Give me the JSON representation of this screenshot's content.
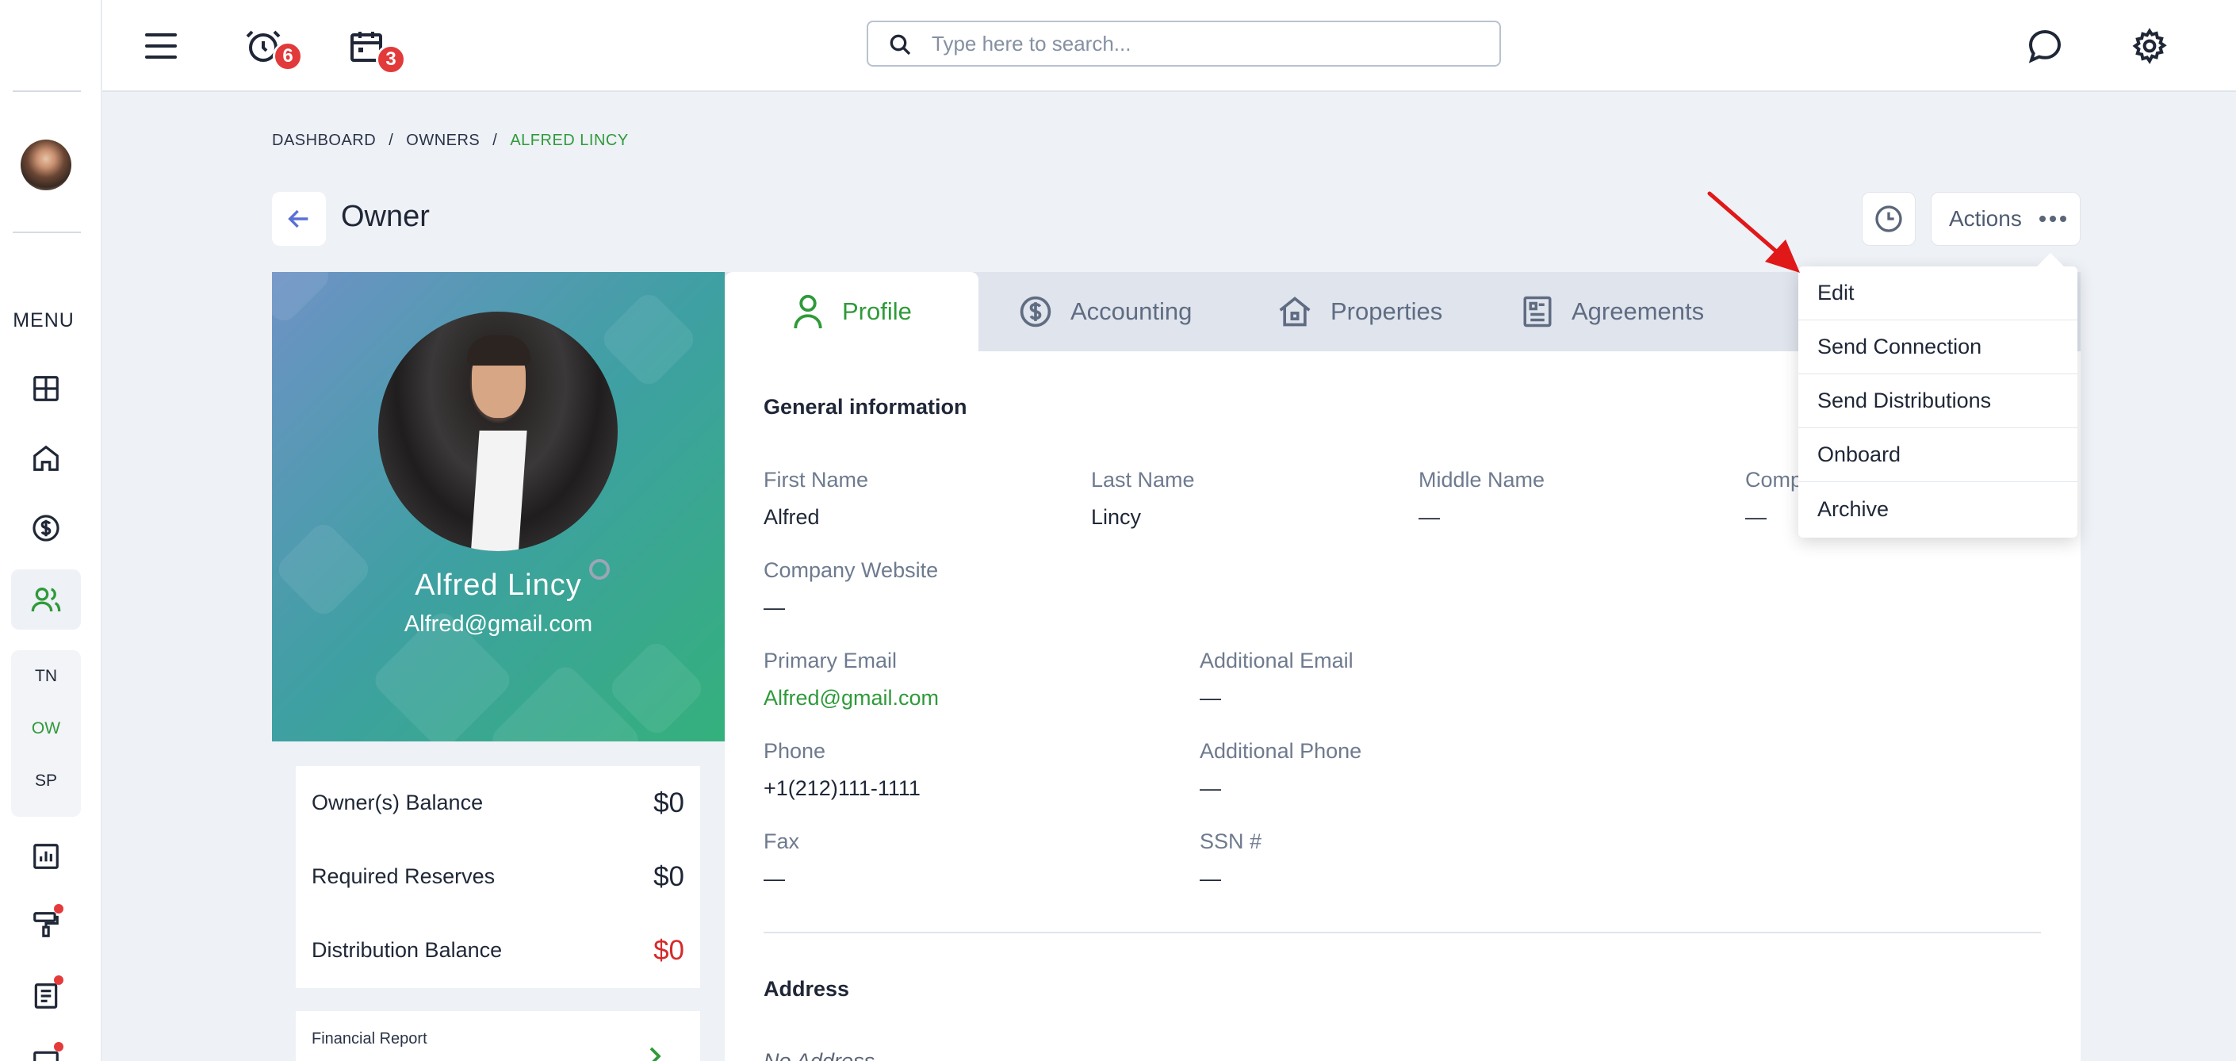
{
  "sidebar": {
    "menu_label": "MENU",
    "sub_nav": [
      "TN",
      "OW",
      "SP"
    ]
  },
  "topbar": {
    "alarm_count": "6",
    "calendar_count": "3",
    "search_placeholder": "Type here to search..."
  },
  "breadcrumb": {
    "items": [
      "DASHBOARD",
      "OWNERS",
      "ALFRED LINCY"
    ],
    "separator": "/"
  },
  "page": {
    "title": "Owner",
    "actions_label": "Actions"
  },
  "actions_menu": [
    "Edit",
    "Send Connection",
    "Send Distributions",
    "Onboard",
    "Archive"
  ],
  "profile": {
    "name": "Alfred Lincy",
    "email": "Alfred@gmail.com"
  },
  "balances": [
    {
      "label": "Owner(s) Balance",
      "value": "$0",
      "color": "#1f2737"
    },
    {
      "label": "Required Reserves",
      "value": "$0",
      "color": "#1f2737"
    },
    {
      "label": "Distribution Balance",
      "value": "$0",
      "color": "#d52a2a"
    }
  ],
  "financial_report": {
    "label": "Financial Report"
  },
  "tabs": [
    "Profile",
    "Accounting",
    "Properties",
    "Agreements"
  ],
  "general": {
    "title": "General information",
    "first_name": {
      "label": "First Name",
      "value": "Alfred"
    },
    "last_name": {
      "label": "Last Name",
      "value": "Lincy"
    },
    "middle_name": {
      "label": "Middle Name",
      "value": "—"
    },
    "company": {
      "label": "Comp",
      "value": "—"
    },
    "company_website": {
      "label": "Company Website",
      "value": "—"
    },
    "primary_email": {
      "label": "Primary Email",
      "value": "Alfred@gmail.com"
    },
    "additional_email": {
      "label": "Additional Email",
      "value": "—"
    },
    "phone": {
      "label": "Phone",
      "value": "+1(212)111-1111"
    },
    "additional_phone": {
      "label": "Additional Phone",
      "value": "—"
    },
    "fax": {
      "label": "Fax",
      "value": "—"
    },
    "ssn": {
      "label": "SSN #",
      "value": "—"
    }
  },
  "address": {
    "title": "Address",
    "empty": "No Address"
  },
  "colors": {
    "accent_green": "#2f9a3a",
    "badge_red": "#e23a3a",
    "annotation_arrow": "#e01818"
  }
}
